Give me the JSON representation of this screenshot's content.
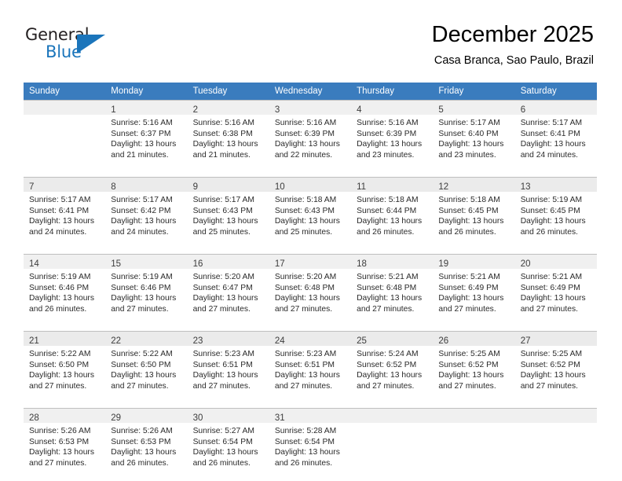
{
  "brand": {
    "name_top": "General",
    "name_bottom": "Blue",
    "triangle_color": "#1b75bb"
  },
  "header": {
    "title": "December 2025",
    "subtitle": "Casa Branca, Sao Paulo, Brazil"
  },
  "theme": {
    "header_row_bg": "#3a7cbe",
    "header_row_text": "#ffffff",
    "daynum_band_bg": "#f0f0f0",
    "cell_border": "#bfbfbf"
  },
  "calendar": {
    "weekday_headers": [
      "Sunday",
      "Monday",
      "Tuesday",
      "Wednesday",
      "Thursday",
      "Friday",
      "Saturday"
    ],
    "weeks": [
      [
        {
          "day": "",
          "sunrise": "",
          "sunset": "",
          "daylight_line1": "",
          "daylight_line2": ""
        },
        {
          "day": "1",
          "sunrise": "Sunrise: 5:16 AM",
          "sunset": "Sunset: 6:37 PM",
          "daylight_line1": "Daylight: 13 hours",
          "daylight_line2": "and 21 minutes."
        },
        {
          "day": "2",
          "sunrise": "Sunrise: 5:16 AM",
          "sunset": "Sunset: 6:38 PM",
          "daylight_line1": "Daylight: 13 hours",
          "daylight_line2": "and 21 minutes."
        },
        {
          "day": "3",
          "sunrise": "Sunrise: 5:16 AM",
          "sunset": "Sunset: 6:39 PM",
          "daylight_line1": "Daylight: 13 hours",
          "daylight_line2": "and 22 minutes."
        },
        {
          "day": "4",
          "sunrise": "Sunrise: 5:16 AM",
          "sunset": "Sunset: 6:39 PM",
          "daylight_line1": "Daylight: 13 hours",
          "daylight_line2": "and 23 minutes."
        },
        {
          "day": "5",
          "sunrise": "Sunrise: 5:17 AM",
          "sunset": "Sunset: 6:40 PM",
          "daylight_line1": "Daylight: 13 hours",
          "daylight_line2": "and 23 minutes."
        },
        {
          "day": "6",
          "sunrise": "Sunrise: 5:17 AM",
          "sunset": "Sunset: 6:41 PM",
          "daylight_line1": "Daylight: 13 hours",
          "daylight_line2": "and 24 minutes."
        }
      ],
      [
        {
          "day": "7",
          "sunrise": "Sunrise: 5:17 AM",
          "sunset": "Sunset: 6:41 PM",
          "daylight_line1": "Daylight: 13 hours",
          "daylight_line2": "and 24 minutes."
        },
        {
          "day": "8",
          "sunrise": "Sunrise: 5:17 AM",
          "sunset": "Sunset: 6:42 PM",
          "daylight_line1": "Daylight: 13 hours",
          "daylight_line2": "and 24 minutes."
        },
        {
          "day": "9",
          "sunrise": "Sunrise: 5:17 AM",
          "sunset": "Sunset: 6:43 PM",
          "daylight_line1": "Daylight: 13 hours",
          "daylight_line2": "and 25 minutes."
        },
        {
          "day": "10",
          "sunrise": "Sunrise: 5:18 AM",
          "sunset": "Sunset: 6:43 PM",
          "daylight_line1": "Daylight: 13 hours",
          "daylight_line2": "and 25 minutes."
        },
        {
          "day": "11",
          "sunrise": "Sunrise: 5:18 AM",
          "sunset": "Sunset: 6:44 PM",
          "daylight_line1": "Daylight: 13 hours",
          "daylight_line2": "and 26 minutes."
        },
        {
          "day": "12",
          "sunrise": "Sunrise: 5:18 AM",
          "sunset": "Sunset: 6:45 PM",
          "daylight_line1": "Daylight: 13 hours",
          "daylight_line2": "and 26 minutes."
        },
        {
          "day": "13",
          "sunrise": "Sunrise: 5:19 AM",
          "sunset": "Sunset: 6:45 PM",
          "daylight_line1": "Daylight: 13 hours",
          "daylight_line2": "and 26 minutes."
        }
      ],
      [
        {
          "day": "14",
          "sunrise": "Sunrise: 5:19 AM",
          "sunset": "Sunset: 6:46 PM",
          "daylight_line1": "Daylight: 13 hours",
          "daylight_line2": "and 26 minutes."
        },
        {
          "day": "15",
          "sunrise": "Sunrise: 5:19 AM",
          "sunset": "Sunset: 6:46 PM",
          "daylight_line1": "Daylight: 13 hours",
          "daylight_line2": "and 27 minutes."
        },
        {
          "day": "16",
          "sunrise": "Sunrise: 5:20 AM",
          "sunset": "Sunset: 6:47 PM",
          "daylight_line1": "Daylight: 13 hours",
          "daylight_line2": "and 27 minutes."
        },
        {
          "day": "17",
          "sunrise": "Sunrise: 5:20 AM",
          "sunset": "Sunset: 6:48 PM",
          "daylight_line1": "Daylight: 13 hours",
          "daylight_line2": "and 27 minutes."
        },
        {
          "day": "18",
          "sunrise": "Sunrise: 5:21 AM",
          "sunset": "Sunset: 6:48 PM",
          "daylight_line1": "Daylight: 13 hours",
          "daylight_line2": "and 27 minutes."
        },
        {
          "day": "19",
          "sunrise": "Sunrise: 5:21 AM",
          "sunset": "Sunset: 6:49 PM",
          "daylight_line1": "Daylight: 13 hours",
          "daylight_line2": "and 27 minutes."
        },
        {
          "day": "20",
          "sunrise": "Sunrise: 5:21 AM",
          "sunset": "Sunset: 6:49 PM",
          "daylight_line1": "Daylight: 13 hours",
          "daylight_line2": "and 27 minutes."
        }
      ],
      [
        {
          "day": "21",
          "sunrise": "Sunrise: 5:22 AM",
          "sunset": "Sunset: 6:50 PM",
          "daylight_line1": "Daylight: 13 hours",
          "daylight_line2": "and 27 minutes."
        },
        {
          "day": "22",
          "sunrise": "Sunrise: 5:22 AM",
          "sunset": "Sunset: 6:50 PM",
          "daylight_line1": "Daylight: 13 hours",
          "daylight_line2": "and 27 minutes."
        },
        {
          "day": "23",
          "sunrise": "Sunrise: 5:23 AM",
          "sunset": "Sunset: 6:51 PM",
          "daylight_line1": "Daylight: 13 hours",
          "daylight_line2": "and 27 minutes."
        },
        {
          "day": "24",
          "sunrise": "Sunrise: 5:23 AM",
          "sunset": "Sunset: 6:51 PM",
          "daylight_line1": "Daylight: 13 hours",
          "daylight_line2": "and 27 minutes."
        },
        {
          "day": "25",
          "sunrise": "Sunrise: 5:24 AM",
          "sunset": "Sunset: 6:52 PM",
          "daylight_line1": "Daylight: 13 hours",
          "daylight_line2": "and 27 minutes."
        },
        {
          "day": "26",
          "sunrise": "Sunrise: 5:25 AM",
          "sunset": "Sunset: 6:52 PM",
          "daylight_line1": "Daylight: 13 hours",
          "daylight_line2": "and 27 minutes."
        },
        {
          "day": "27",
          "sunrise": "Sunrise: 5:25 AM",
          "sunset": "Sunset: 6:52 PM",
          "daylight_line1": "Daylight: 13 hours",
          "daylight_line2": "and 27 minutes."
        }
      ],
      [
        {
          "day": "28",
          "sunrise": "Sunrise: 5:26 AM",
          "sunset": "Sunset: 6:53 PM",
          "daylight_line1": "Daylight: 13 hours",
          "daylight_line2": "and 27 minutes."
        },
        {
          "day": "29",
          "sunrise": "Sunrise: 5:26 AM",
          "sunset": "Sunset: 6:53 PM",
          "daylight_line1": "Daylight: 13 hours",
          "daylight_line2": "and 26 minutes."
        },
        {
          "day": "30",
          "sunrise": "Sunrise: 5:27 AM",
          "sunset": "Sunset: 6:54 PM",
          "daylight_line1": "Daylight: 13 hours",
          "daylight_line2": "and 26 minutes."
        },
        {
          "day": "31",
          "sunrise": "Sunrise: 5:28 AM",
          "sunset": "Sunset: 6:54 PM",
          "daylight_line1": "Daylight: 13 hours",
          "daylight_line2": "and 26 minutes."
        },
        {
          "day": "",
          "sunrise": "",
          "sunset": "",
          "daylight_line1": "",
          "daylight_line2": ""
        },
        {
          "day": "",
          "sunrise": "",
          "sunset": "",
          "daylight_line1": "",
          "daylight_line2": ""
        },
        {
          "day": "",
          "sunrise": "",
          "sunset": "",
          "daylight_line1": "",
          "daylight_line2": ""
        }
      ]
    ]
  }
}
